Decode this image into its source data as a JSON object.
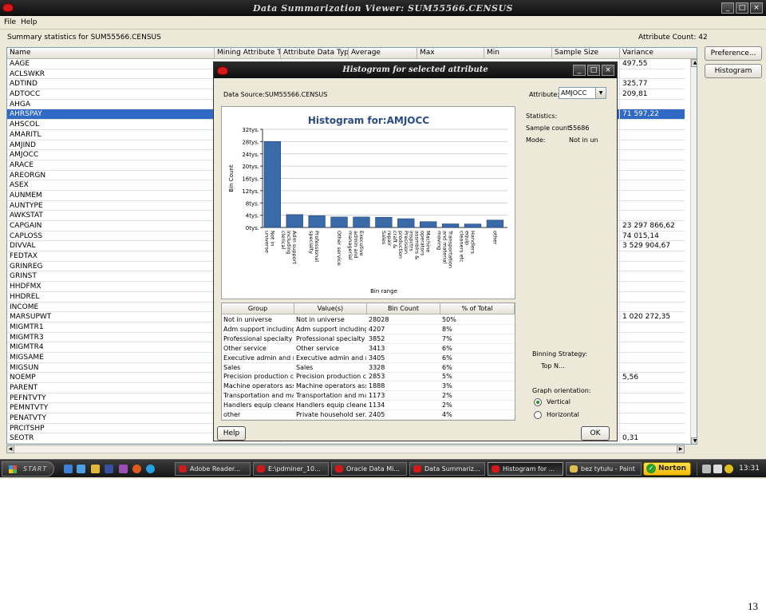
{
  "window": {
    "title": "Data Summarization Viewer: SUM55566.CENSUS"
  },
  "menu": {
    "file": "File",
    "help": "Help"
  },
  "summary_label": "Summary statistics for SUM55566.CENSUS",
  "attribute_count": "Attribute Count: 42",
  "table": {
    "columns": [
      "Name",
      "Mining Attribute T...",
      "Attribute Data Type",
      "Average",
      "Max",
      "Min",
      "Sample Size",
      "Variance"
    ],
    "rows": [
      {
        "name": "AAGE",
        "variance": "497,55"
      },
      {
        "name": "ACLSWKR",
        "variance": ""
      },
      {
        "name": "ADTIND",
        "variance": "325,77"
      },
      {
        "name": "ADTOCC",
        "variance": "209,81"
      },
      {
        "name": "AHGA",
        "variance": ""
      },
      {
        "name": "AHRSPAY",
        "variance": "71 597,22"
      },
      {
        "name": "AHSCOL",
        "variance": ""
      },
      {
        "name": "AMARITL",
        "variance": ""
      },
      {
        "name": "AMJIND",
        "variance": ""
      },
      {
        "name": "AMJOCC",
        "variance": ""
      },
      {
        "name": "ARACE",
        "variance": ""
      },
      {
        "name": "AREORGN",
        "variance": ""
      },
      {
        "name": "ASEX",
        "variance": ""
      },
      {
        "name": "AUNMEM",
        "variance": ""
      },
      {
        "name": "AUNTYPE",
        "variance": ""
      },
      {
        "name": "AWKSTAT",
        "variance": ""
      },
      {
        "name": "CAPGAIN",
        "variance": "23 297 866,62"
      },
      {
        "name": "CAPLOSS",
        "variance": "74 015,14"
      },
      {
        "name": "DIVVAL",
        "variance": "3 529 904,67"
      },
      {
        "name": "FEDTAX",
        "variance": ""
      },
      {
        "name": "GRINREG",
        "variance": ""
      },
      {
        "name": "GRINST",
        "variance": ""
      },
      {
        "name": "HHDFMX",
        "variance": ""
      },
      {
        "name": "HHDREL",
        "variance": ""
      },
      {
        "name": "INCOME",
        "variance": ""
      },
      {
        "name": "MARSUPWT",
        "variance": "1 020 272,35"
      },
      {
        "name": "MIGMTR1",
        "variance": ""
      },
      {
        "name": "MIGMTR3",
        "variance": ""
      },
      {
        "name": "MIGMTR4",
        "variance": ""
      },
      {
        "name": "MIGSAME",
        "variance": ""
      },
      {
        "name": "MIGSUN",
        "variance": ""
      },
      {
        "name": "NOEMP",
        "variance": "5,56"
      },
      {
        "name": "PARENT",
        "variance": ""
      },
      {
        "name": "PEFNTVTY",
        "variance": ""
      },
      {
        "name": "PEMNTVTY",
        "variance": ""
      },
      {
        "name": "PENATVTY",
        "variance": ""
      },
      {
        "name": "PRCITSHP",
        "variance": ""
      },
      {
        "name": "SEOTR",
        "variance": "0,31"
      }
    ]
  },
  "buttons": {
    "preference": "Preference...",
    "histogram": "Histogram",
    "help": "Help",
    "ok": "OK"
  },
  "dialog": {
    "title": "Histogram for selected attribute",
    "data_source": "Data Source:SUM55566.CENSUS",
    "attribute_label": "Attribute:",
    "attribute_value": "AMJOCC",
    "statistics_label": "Statistics:",
    "sample_count_label": "Sample count:",
    "sample_count_value": "55686",
    "mode_label": "Mode:",
    "mode_value": "Not in un",
    "binning_strategy_label": "Binning Strategy:",
    "binning_strategy_value": "Top N...",
    "graph_orientation_label": "Graph orientation:",
    "orientation_vertical": "Vertical",
    "orientation_horizontal": "Horizontal"
  },
  "chart_data": {
    "type": "bar",
    "title": "Histogram for:AMJOCC",
    "xlabel": "Bin range",
    "ylabel": "Bin Count",
    "ylim": [
      0,
      32000
    ],
    "y_ticks": [
      "0tys.",
      "4tys.",
      "8tys.",
      "12tys.",
      "16tys.",
      "20tys.",
      "24tys.",
      "28tys.",
      "32tys."
    ],
    "categories": [
      "Not in universe",
      "Adm support including clerical",
      "Professional specialty",
      "Other service",
      "Executive admin and managerial",
      "Sales",
      "Precision production craft & repair",
      "Machine operators assmblrs & inspctrs",
      "Transportation and material moving",
      "Handlers equip cleaners etc",
      "other"
    ],
    "values": [
      28028,
      4207,
      3852,
      3413,
      3405,
      3328,
      2853,
      1888,
      1173,
      1134,
      2405
    ],
    "colors": {
      "bar": "#3a6aa8",
      "title": "#2a4a8a"
    },
    "grid": true
  },
  "group_table": {
    "columns": [
      "Group",
      "Value(s)",
      "Bin Count",
      "% of Total"
    ],
    "rows": [
      [
        "Not in universe",
        "Not in universe",
        "28028",
        "50%"
      ],
      [
        "Adm support including ...",
        "Adm support including ...",
        "4207",
        "8%"
      ],
      [
        "Professional specialty",
        "Professional specialty",
        "3852",
        "7%"
      ],
      [
        "Other service",
        "Other service",
        "3413",
        "6%"
      ],
      [
        "Executive admin and m...",
        "Executive admin and m...",
        "3405",
        "6%"
      ],
      [
        "Sales",
        "Sales",
        "3328",
        "6%"
      ],
      [
        "Precision production cr...",
        "Precision production c...",
        "2853",
        "5%"
      ],
      [
        "Machine operators ass...",
        "Machine operators ass...",
        "1888",
        "3%"
      ],
      [
        "Transportation and mat...",
        "Transportation and ma...",
        "1173",
        "2%"
      ],
      [
        "Handlers equip cleaner...",
        "Handlers equip cleane...",
        "1134",
        "2%"
      ],
      [
        "other",
        "Private household ser...",
        "2405",
        "4%"
      ]
    ]
  },
  "taskbar": {
    "start": "START",
    "tasks": [
      "Adobe Reader...",
      "E:\\pdminer_10...",
      "Oracle Data Mi...",
      "Data Summariz...",
      "Histogram for ...",
      "bez tytułu - Paint"
    ],
    "norton": "Norton",
    "clock": "13:31"
  },
  "page_number": "13"
}
